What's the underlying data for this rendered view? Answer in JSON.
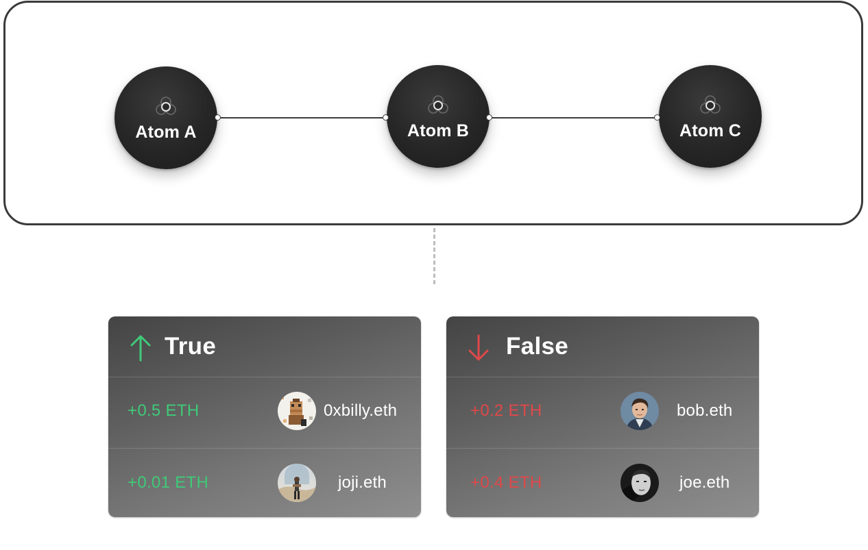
{
  "atoms": [
    {
      "label": "Atom A"
    },
    {
      "label": "Atom B"
    },
    {
      "label": "Atom C"
    }
  ],
  "atom_icon": "triple-ring-atom-icon",
  "cards": [
    {
      "title": "True",
      "direction_icon": "arrow-up-icon",
      "accent_color": "#3fca78",
      "rows": [
        {
          "amount": "+0.5 ETH",
          "user": "0xbilly.eth",
          "avatar": "pixel-art-avatar"
        },
        {
          "amount": "+0.01 ETH",
          "user": "joji.eth",
          "avatar": "landscape-photo-avatar"
        }
      ]
    },
    {
      "title": "False",
      "direction_icon": "arrow-down-icon",
      "accent_color": "#e0484a",
      "rows": [
        {
          "amount": "+0.2 ETH",
          "user": "bob.eth",
          "avatar": "portrait-photo-avatar"
        },
        {
          "amount": "+0.4 ETH",
          "user": "joe.eth",
          "avatar": "bw-portrait-avatar"
        }
      ]
    }
  ]
}
